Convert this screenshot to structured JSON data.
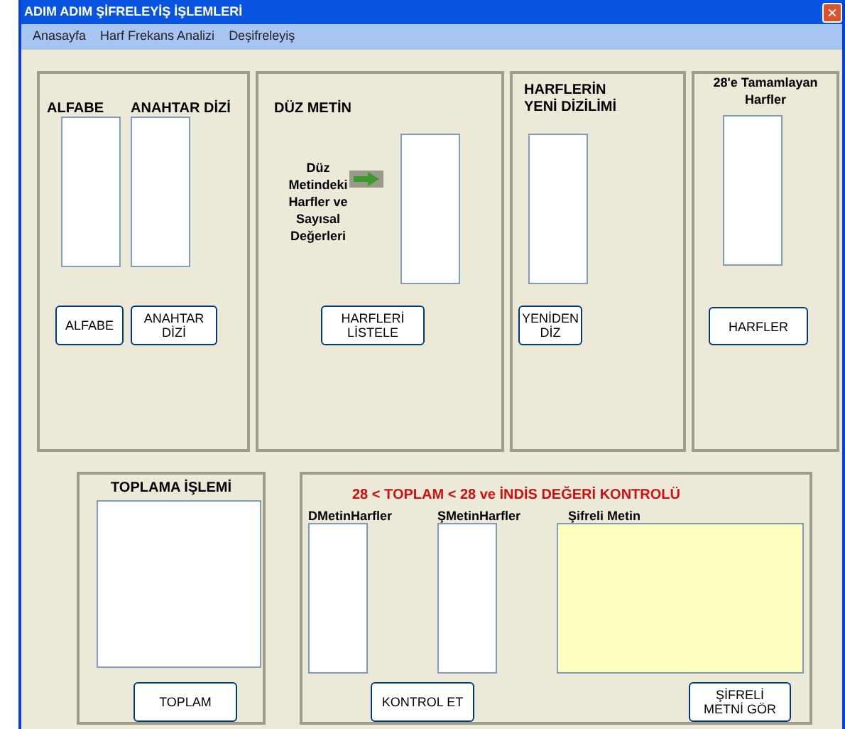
{
  "window": {
    "title": "ADIM ADIM ŞİFRELEYİŞ İŞLEMLERİ",
    "close": "×"
  },
  "menu": [
    "Anasayfa",
    "Harf Frekans Analizi",
    "Deşifreleyiş"
  ],
  "alfabe_panel": {
    "labels": [
      "ALFABE",
      "ANAHTAR DİZİ"
    ],
    "buttons": [
      "ALFABE",
      "ANAHTAR\nDİZİ"
    ]
  },
  "duz_metin_panel": {
    "heading": "DÜZ METİN",
    "caption": "Düz\nMetindeki\nHarfler ve\nSayısal\nDeğerleri",
    "button": "HARFLERİ\nLİSTELE"
  },
  "yeni_dizilim_panel": {
    "heading": "HARFLERİN\nYENİ DİZİLİMİ",
    "button": "YENİDEN\nDİZ"
  },
  "tamamlayan_panel": {
    "heading": "28'e Tamamlayan\nHarfler",
    "button": "HARFLER"
  },
  "toplama_panel": {
    "heading": "TOPLAMA İŞLEMİ",
    "button": "TOPLAM"
  },
  "kontrol_panel": {
    "heading": "28 < TOPLAM < 28 ve İNDİS DEĞERİ KONTROLÜ",
    "labels": [
      "DMetinHarfler",
      "ŞMetinHarfler",
      "Şifreli Metin"
    ],
    "buttons": [
      "KONTROL ET",
      "ŞİFRELİ\nMETNİ GÖR"
    ]
  }
}
